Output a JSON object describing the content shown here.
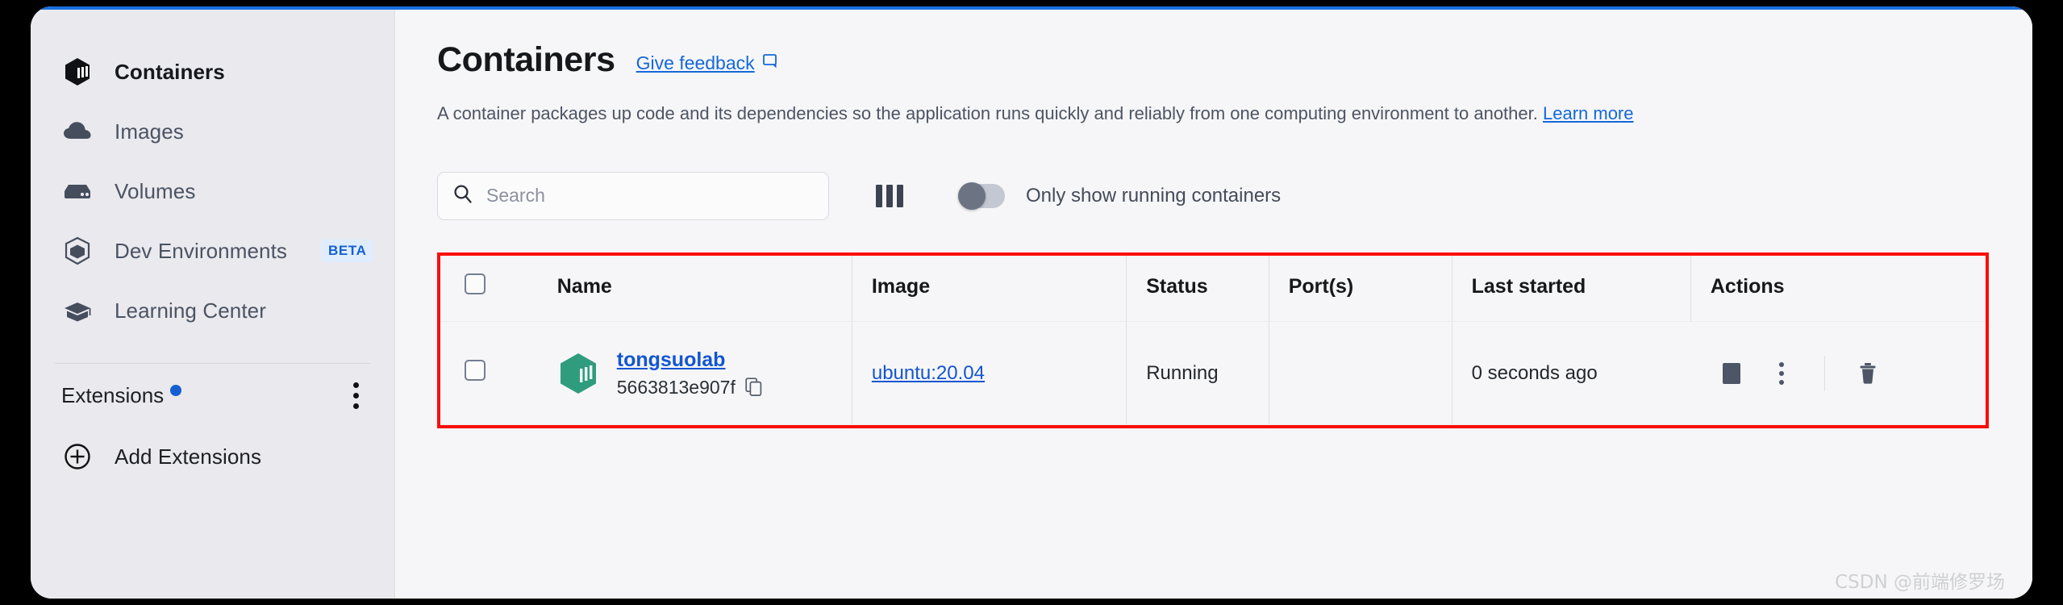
{
  "colors": {
    "accent_blue": "#1568d8",
    "link_blue": "#1355d0",
    "container_green": "#2f9c7d",
    "highlight_red": "#fb0d09",
    "sidebar_bg": "#e9e9ee",
    "main_bg": "#f6f6f8"
  },
  "sidebar": {
    "items": [
      {
        "label": "Containers",
        "icon": "container-cube-icon",
        "active": true
      },
      {
        "label": "Images",
        "icon": "cloud-icon",
        "active": false
      },
      {
        "label": "Volumes",
        "icon": "volume-drive-icon",
        "active": false
      },
      {
        "label": "Dev Environments",
        "icon": "dev-environments-box-icon",
        "badge": "BETA",
        "active": false
      },
      {
        "label": "Learning Center",
        "icon": "graduation-cap-icon",
        "active": false
      }
    ],
    "extensions": {
      "label": "Extensions",
      "has_notification_dot": true,
      "menu_icon": "kebab-menu-icon"
    },
    "add_extensions": {
      "label": "Add Extensions",
      "icon": "plus-circle-icon"
    }
  },
  "header": {
    "title": "Containers",
    "feedback_label": "Give feedback",
    "feedback_icon": "feedback-comment-icon",
    "description_text": "A container packages up code and its dependencies so the application runs quickly and reliably from one computing environment to another.",
    "learn_more_label": "Learn more"
  },
  "toolbar": {
    "search": {
      "placeholder": "Search",
      "value": "",
      "icon": "search-icon"
    },
    "columns_icon": "column-settings-icon",
    "toggle": {
      "label": "Only show running containers",
      "on": false
    }
  },
  "table": {
    "columns": [
      {
        "key": "checkbox",
        "label": ""
      },
      {
        "key": "name",
        "label": "Name"
      },
      {
        "key": "image",
        "label": "Image"
      },
      {
        "key": "status",
        "label": "Status"
      },
      {
        "key": "ports",
        "label": "Port(s)"
      },
      {
        "key": "last_started",
        "label": "Last started"
      },
      {
        "key": "actions",
        "label": "Actions"
      }
    ],
    "rows": [
      {
        "selected": false,
        "icon": "container-cube-icon",
        "name": "tongsuolab",
        "container_id": "5663813e907f",
        "copy_icon": "copy-icon",
        "image": "ubuntu:20.04",
        "status": "Running",
        "ports": "",
        "last_started": "0 seconds ago",
        "actions": {
          "stop_icon": "stop-square-icon",
          "menu_icon": "kebab-menu-icon",
          "delete_icon": "trash-icon"
        }
      }
    ]
  },
  "watermark": {
    "text": "CSDN @前端修罗场"
  }
}
